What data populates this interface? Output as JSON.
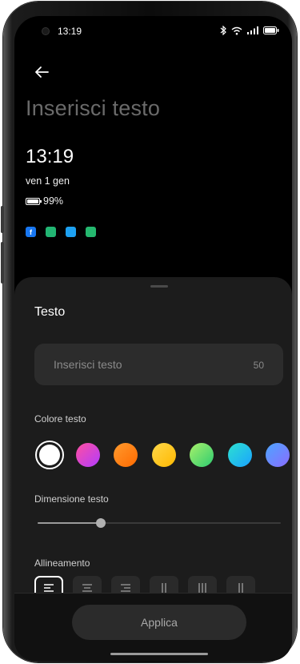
{
  "status_bar": {
    "time": "13:19"
  },
  "preview": {
    "title_placeholder": "Inserisci testo",
    "clock": "13:19",
    "date": "ven 1 gen",
    "battery": "99%",
    "app_icons": [
      {
        "name": "facebook",
        "color": "#1877f2",
        "glyph": "f"
      },
      {
        "name": "messages",
        "color": "#22b573",
        "glyph": ""
      },
      {
        "name": "twitter",
        "color": "#1da1f2",
        "glyph": ""
      },
      {
        "name": "phone",
        "color": "#25b86f",
        "glyph": ""
      }
    ]
  },
  "sheet": {
    "title": "Testo",
    "input": {
      "placeholder": "Inserisci testo",
      "max_length": "50"
    },
    "color_label": "Colore testo",
    "colors": [
      {
        "name": "white",
        "value": "#ffffff",
        "selected": true
      },
      {
        "name": "magenta",
        "value": "linear-gradient(135deg,#ff4fa0,#b13cff)",
        "selected": false
      },
      {
        "name": "orange",
        "value": "linear-gradient(135deg,#ff9a2e,#ff6a00)",
        "selected": false
      },
      {
        "name": "yellow",
        "value": "linear-gradient(135deg,#ffd84a,#ffb800)",
        "selected": false
      },
      {
        "name": "green",
        "value": "linear-gradient(135deg,#a8f06a,#2ecc71)",
        "selected": false
      },
      {
        "name": "cyan",
        "value": "linear-gradient(135deg,#2de0d0,#1aa3ff)",
        "selected": false
      },
      {
        "name": "blue-purple",
        "value": "linear-gradient(135deg,#4da6ff,#8a6bff)",
        "selected": false
      }
    ],
    "size_label": "Dimensione testo",
    "size_value": 0.26,
    "alignment_label": "Allineamento",
    "alignments": [
      {
        "name": "align-left",
        "selected": true
      },
      {
        "name": "align-center",
        "selected": false
      },
      {
        "name": "align-right",
        "selected": false
      },
      {
        "name": "vertical-2",
        "selected": false
      },
      {
        "name": "vertical-3",
        "selected": false
      },
      {
        "name": "vertical-2b",
        "selected": false
      }
    ],
    "apply_label": "Applica"
  }
}
